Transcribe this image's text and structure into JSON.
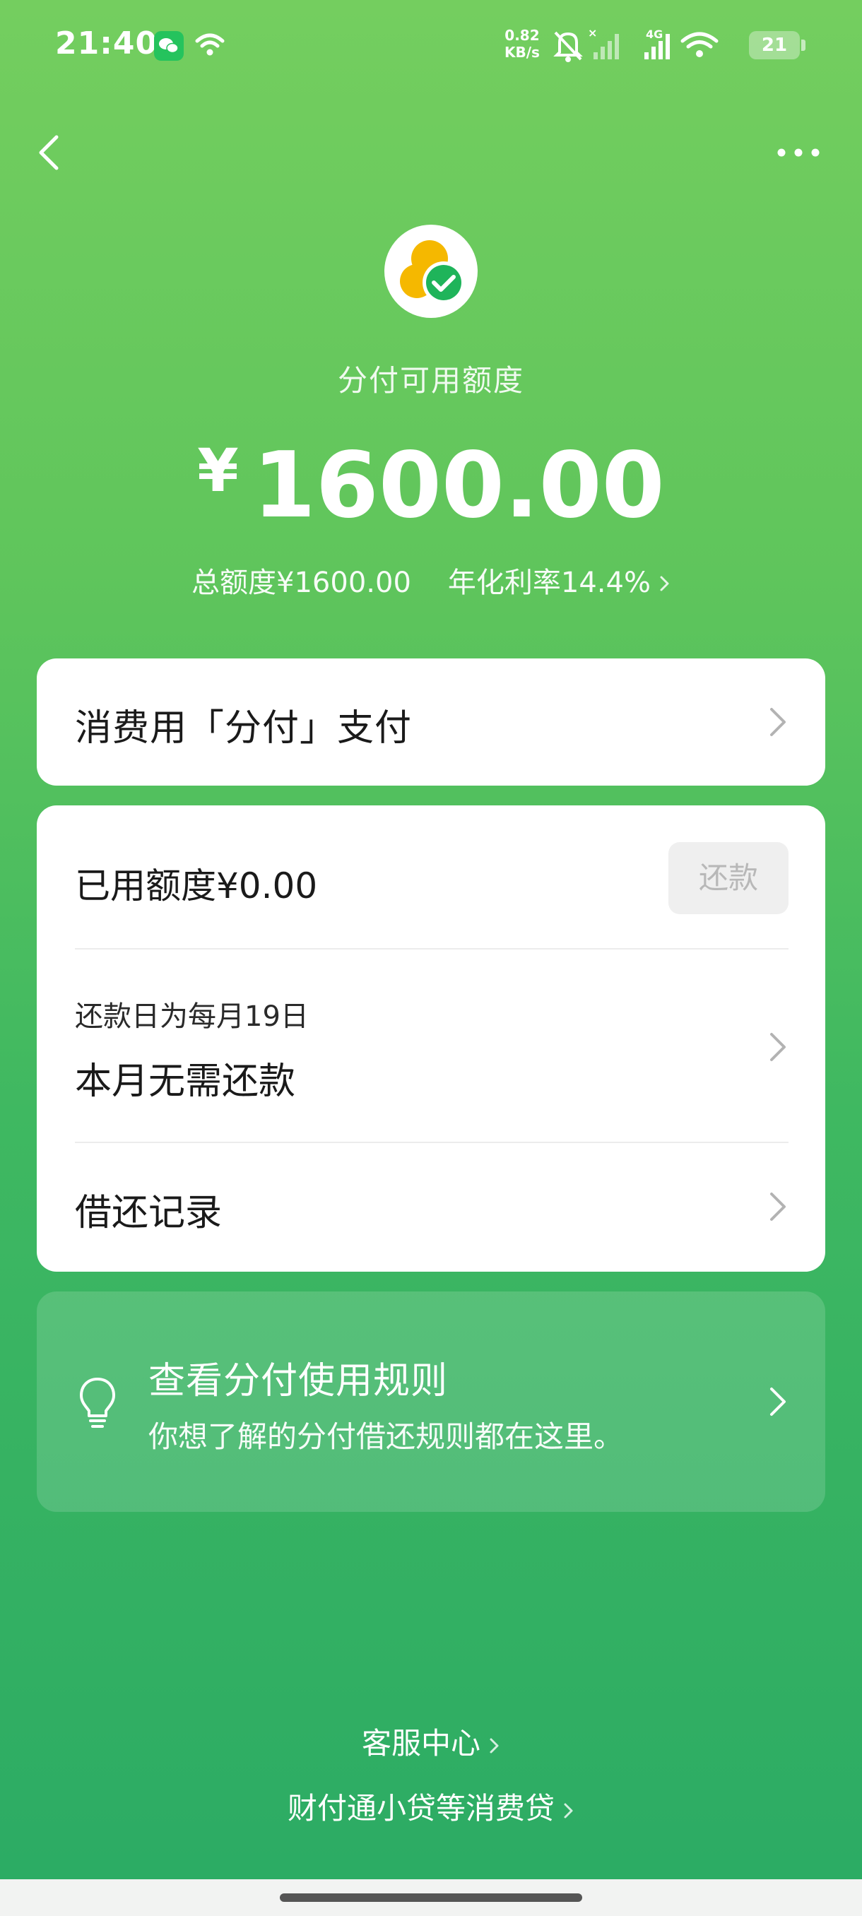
{
  "status_bar": {
    "time": "21:40",
    "net_speed_value": "0.82",
    "net_speed_unit": "KB/s",
    "network": "4G",
    "battery": "21"
  },
  "header": {
    "available_label": "分付可用额度",
    "currency_symbol": "¥",
    "available_amount": "1600.00",
    "total_limit": "总额度¥1600.00",
    "annual_rate": "年化利率14.4%"
  },
  "pay_card": {
    "title": "消费用「分付」支付"
  },
  "info_card": {
    "used_label": "已用额度¥0.00",
    "repay_button": "还款",
    "due_date": "还款日为每月19日",
    "due_status": "本月无需还款",
    "records_label": "借还记录"
  },
  "rules_card": {
    "title": "查看分付使用规则",
    "subtitle": "你想了解的分付借还规则都在这里。"
  },
  "footer": {
    "service_center": "客服中心",
    "consumer_loans": "财付通小贷等消费贷"
  },
  "colors": {
    "gradient_top": "#74ce5f",
    "gradient_bottom": "#2bab64",
    "card_bg": "#ffffff",
    "logo_yellow": "#f5b800",
    "logo_green": "#1fb45a"
  }
}
